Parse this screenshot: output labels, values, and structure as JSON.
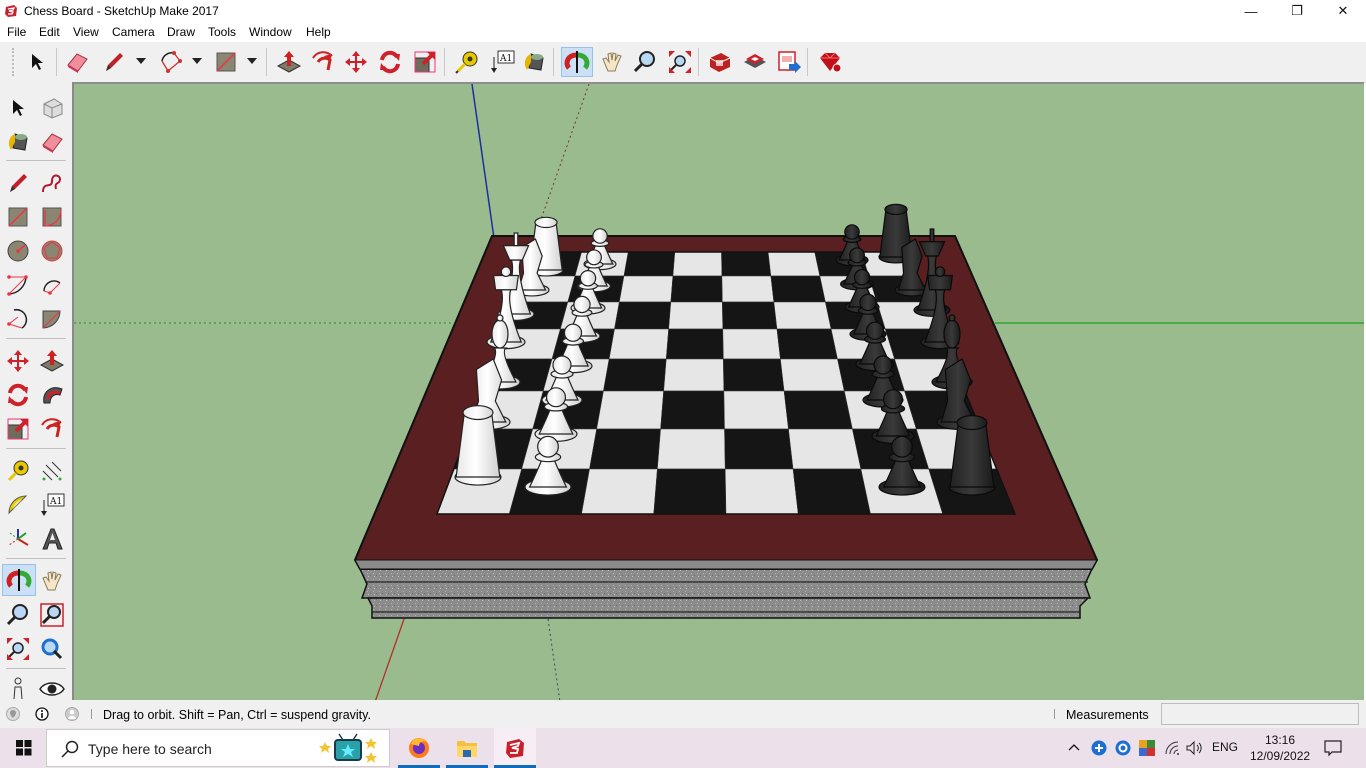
{
  "window": {
    "title": "Chess Board - SketchUp Make 2017",
    "app_icon": "sketchup-logo-icon",
    "controls": {
      "minimize": "—",
      "restore": "❐",
      "close": "✕"
    }
  },
  "menubar": {
    "items": [
      "File",
      "Edit",
      "View",
      "Camera",
      "Draw",
      "Tools",
      "Window",
      "Help"
    ]
  },
  "toolbar": {
    "tools": [
      {
        "name": "select",
        "icon": "select-arrow-icon"
      },
      {
        "name": "eraser",
        "icon": "eraser-icon"
      },
      {
        "name": "line",
        "icon": "pencil-icon",
        "dropdown": true
      },
      {
        "name": "arc",
        "icon": "arc-icon",
        "dropdown": true
      },
      {
        "name": "rectangle",
        "icon": "rectangle-icon",
        "dropdown": true
      },
      {
        "name": "push-pull",
        "icon": "push-pull-icon"
      },
      {
        "name": "offset",
        "icon": "offset-icon"
      },
      {
        "name": "move",
        "icon": "move-icon"
      },
      {
        "name": "rotate",
        "icon": "rotate-icon"
      },
      {
        "name": "scale",
        "icon": "scale-icon"
      },
      {
        "name": "tape-measure",
        "icon": "tape-measure-icon"
      },
      {
        "name": "text",
        "icon": "text-icon",
        "label": "A1"
      },
      {
        "name": "paint-bucket",
        "icon": "paint-bucket-icon"
      },
      {
        "name": "orbit",
        "icon": "orbit-icon",
        "active": true
      },
      {
        "name": "pan",
        "icon": "hand-icon"
      },
      {
        "name": "zoom",
        "icon": "magnifier-icon"
      },
      {
        "name": "zoom-extents",
        "icon": "zoom-extents-icon"
      },
      {
        "name": "3d-warehouse",
        "icon": "warehouse-icon"
      },
      {
        "name": "extension-warehouse",
        "icon": "extension-warehouse-icon"
      },
      {
        "name": "share-model",
        "icon": "share-model-icon"
      },
      {
        "name": "extension-manager",
        "icon": "ruby-gem-icon"
      }
    ]
  },
  "left_toolbar": {
    "text_label": "A1"
  },
  "viewport": {
    "background": "#9abb8e",
    "model": "chess-board",
    "axis_colors": {
      "red": "#b0302a",
      "green": "#2fa52f",
      "blue": "#2030a0"
    },
    "board_frame_color": "#5a1f20",
    "base_color": "#8e8e8e",
    "light_square": "#e6e6e6",
    "dark_square": "#151515",
    "white_pieces": "#f4f4f4",
    "black_pieces": "#2a2a2a"
  },
  "statusbar": {
    "message": "Drag to orbit. Shift = Pan, Ctrl = suspend gravity.",
    "measurements_label": "Measurements",
    "measurements_value": ""
  },
  "taskbar": {
    "search_placeholder": "Type here to search",
    "apps": [
      "firefox",
      "file-explorer",
      "sketchup"
    ],
    "tray": {
      "language": "ENG",
      "time": "13:16",
      "date": "12/09/2022"
    }
  }
}
